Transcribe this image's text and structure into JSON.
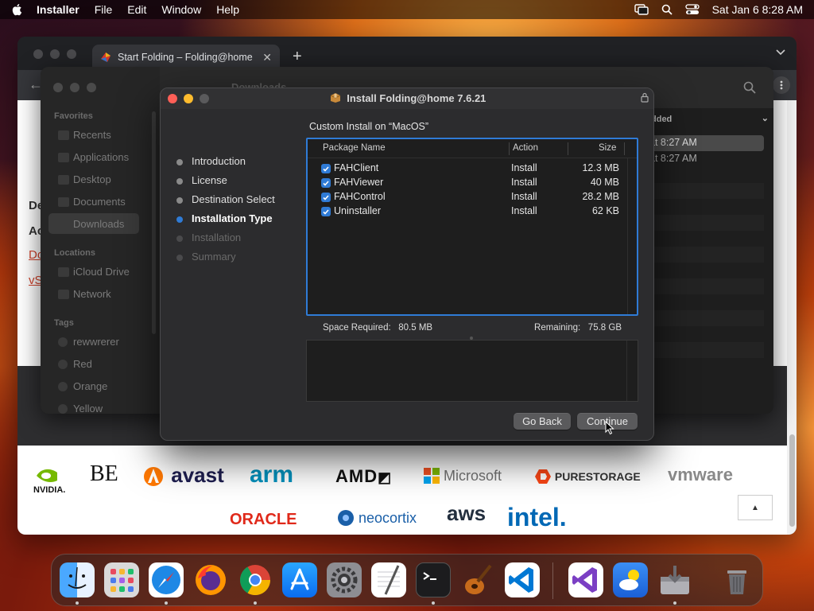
{
  "menubar": {
    "app": "Installer",
    "items": [
      "File",
      "Edit",
      "Window",
      "Help"
    ],
    "datetime": "Sat Jan 6  8:28 AM"
  },
  "browser": {
    "tab_title": "Start Folding – Folding@home",
    "page_side_text": [
      "De",
      "Ac"
    ],
    "page_side_links": [
      "Do",
      "vS"
    ]
  },
  "logos": [
    "NVIDIA.",
    "BE",
    "avast",
    "arm",
    "AMD",
    "Microsoft",
    "PURESTORAGE",
    "vmware",
    "ORACLE",
    "neocortix",
    "aws",
    "intel."
  ],
  "finder": {
    "title": "Downloads",
    "sections": {
      "favorites": "Favorites",
      "locations": "Locations",
      "tags": "Tags"
    },
    "favorites": [
      "Recents",
      "Applications",
      "Desktop",
      "Documents",
      "Downloads"
    ],
    "locations": [
      "iCloud Drive",
      "Network"
    ],
    "tags": [
      "rewwrerer",
      "Red",
      "Orange",
      "Yellow"
    ],
    "column_header": "dded",
    "dates": [
      "at 8:27 AM",
      "at 8:27 AM"
    ]
  },
  "installer": {
    "title": "Install Folding@home 7.6.21",
    "heading": "Custom Install on “MacOS”",
    "steps": [
      {
        "label": "Introduction",
        "state": "done"
      },
      {
        "label": "License",
        "state": "done"
      },
      {
        "label": "Destination Select",
        "state": "done"
      },
      {
        "label": "Installation Type",
        "state": "current"
      },
      {
        "label": "Installation",
        "state": "pending"
      },
      {
        "label": "Summary",
        "state": "pending"
      }
    ],
    "table": {
      "headers": {
        "name": "Package Name",
        "action": "Action",
        "size": "Size"
      },
      "rows": [
        {
          "name": "FAHClient",
          "action": "Install",
          "size": "12.3 MB",
          "checked": true
        },
        {
          "name": "FAHViewer",
          "action": "Install",
          "size": "40 MB",
          "checked": true
        },
        {
          "name": "FAHControl",
          "action": "Install",
          "size": "28.2 MB",
          "checked": true
        },
        {
          "name": "Uninstaller",
          "action": "Install",
          "size": "62 KB",
          "checked": true
        }
      ]
    },
    "space_required_label": "Space Required:",
    "space_required": "80.5 MB",
    "remaining_label": "Remaining:",
    "remaining": "75.8 GB",
    "go_back": "Go Back",
    "continue": "Continue"
  },
  "dock": {
    "apps": [
      "Finder",
      "Launchpad",
      "Safari",
      "Firefox",
      "Chrome",
      "App Store",
      "System Settings",
      "TextEdit",
      "Terminal",
      "GarageBand",
      "Visual Studio Code",
      "Visual Studio",
      "Weather",
      "Installer",
      "Trash"
    ]
  },
  "colors": {
    "accent": "#2f7bd6",
    "close": "#ff5f57",
    "minimize": "#febc2e"
  }
}
